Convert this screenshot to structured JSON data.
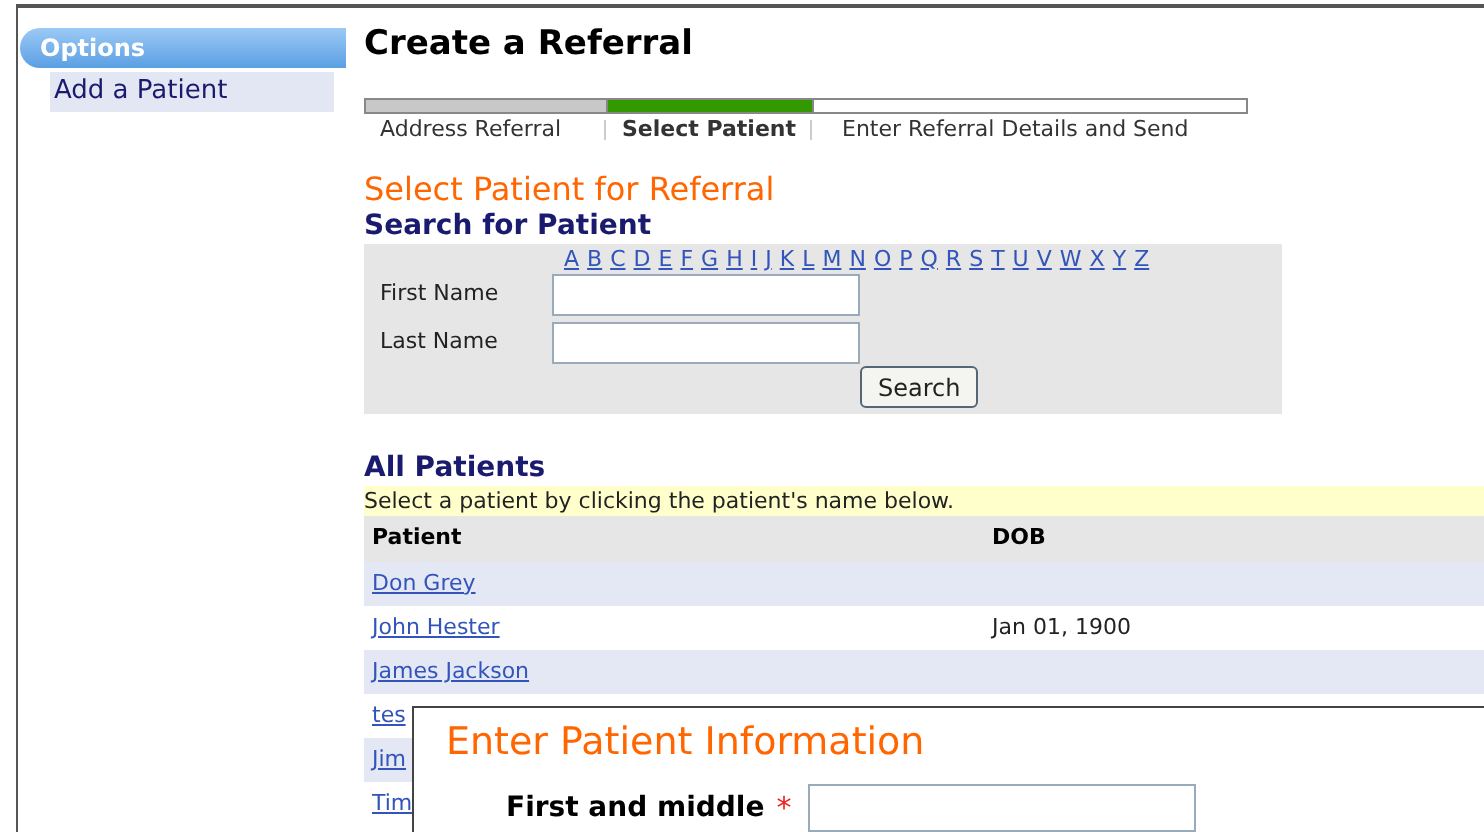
{
  "sidebar": {
    "title": "Options",
    "items": [
      {
        "label": "Add a Patient"
      }
    ]
  },
  "page_title": "Create a Referral",
  "steps": [
    {
      "label": "Address Referral",
      "completed": true,
      "selected": false
    },
    {
      "label": "Select Patient",
      "completed": false,
      "selected": true
    },
    {
      "label": "Enter Referral Details and Send",
      "completed": false,
      "selected": false
    }
  ],
  "section_title": "Select Patient for Referral",
  "search": {
    "title": "Search for Patient",
    "letters": [
      "A",
      "B",
      "C",
      "D",
      "E",
      "F",
      "G",
      "H",
      "I",
      "J",
      "K",
      "L",
      "M",
      "N",
      "O",
      "P",
      "Q",
      "R",
      "S",
      "T",
      "U",
      "V",
      "W",
      "X",
      "Y",
      "Z"
    ],
    "first_name_label": "First Name",
    "last_name_label": "Last Name",
    "button": "Search"
  },
  "patients": {
    "title": "All Patients",
    "hint": "Select a patient by clicking the patient's name below.",
    "columns": [
      "Patient",
      "DOB"
    ],
    "rows": [
      {
        "name": "Don Grey"
      },
      {
        "name": "John Hester",
        "dob": "Jan 01, 1900"
      },
      {
        "name": "James Jackson"
      },
      {
        "name": "tes"
      },
      {
        "name": "Jim"
      },
      {
        "name": "Tim"
      }
    ]
  },
  "dialog": {
    "title": "Enter Patient Information",
    "field_label": "First and middle",
    "required_mark": "*"
  }
}
